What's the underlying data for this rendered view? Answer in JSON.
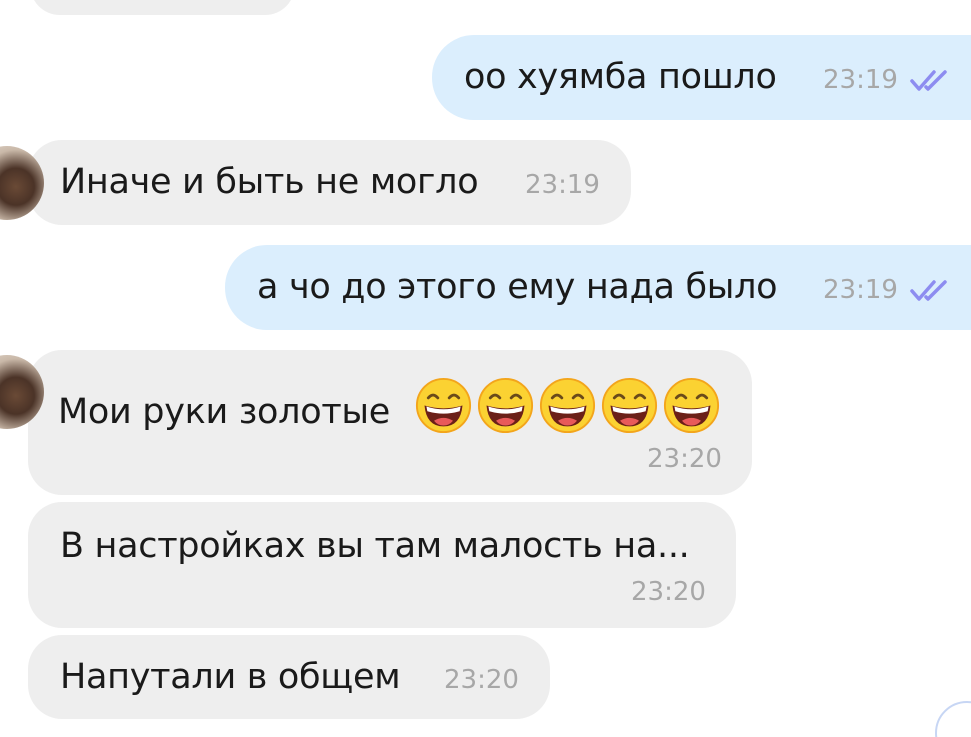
{
  "messages": [
    {
      "text": "оо хуямба пошло",
      "time": "23:19"
    },
    {
      "text": "Иначе и быть не могло",
      "time": "23:19"
    },
    {
      "text": "а чо до этого ему нада было",
      "time": "23:19"
    },
    {
      "text": "Мои руки золотые",
      "time": "23:20",
      "emoji": "grinning-face-with-smiling-eyes",
      "emoji_count": 5
    },
    {
      "text": "В настройках вы там малость на...",
      "time": "23:20"
    },
    {
      "text": "Напутали в общем",
      "time": "23:20"
    }
  ],
  "colors": {
    "outgoing_bubble": "#dbeefd",
    "incoming_bubble": "#eeeeee",
    "time_text": "#a7a7a7",
    "read_check": "#8d8cf0"
  },
  "icons": {
    "read_status": "double-check-icon",
    "emoji": "grinning-face-emoji-icon"
  }
}
